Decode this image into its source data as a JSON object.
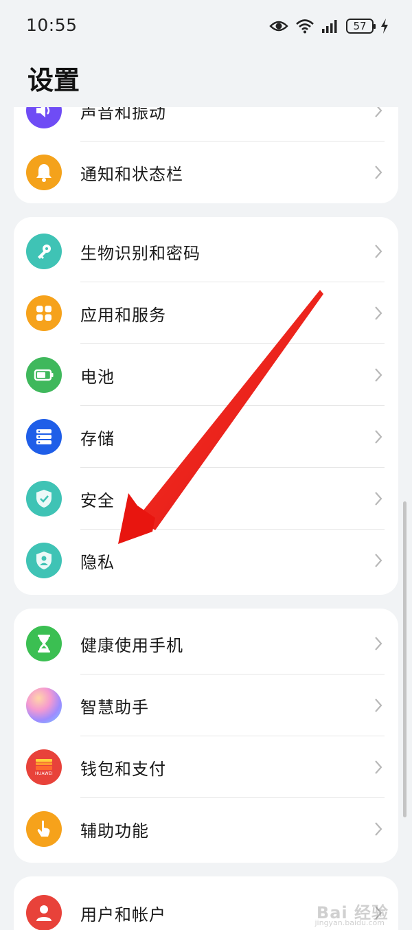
{
  "status_bar": {
    "time": "10:55",
    "battery": "57",
    "icons": [
      "eye-icon",
      "wifi-icon",
      "signal-icon",
      "battery-icon",
      "charging-icon"
    ]
  },
  "page": {
    "title": "设置"
  },
  "groups": [
    {
      "items": [
        {
          "label": "声音和振动",
          "icon": "speaker-icon",
          "color": "#6f4cf5"
        },
        {
          "label": "通知和状态栏",
          "icon": "bell-icon",
          "color": "#f4a21b"
        }
      ]
    },
    {
      "items": [
        {
          "label": "生物识别和密码",
          "icon": "key-icon",
          "color": "#3fc3b5"
        },
        {
          "label": "应用和服务",
          "icon": "apps-grid-icon",
          "color": "#f6a21b"
        },
        {
          "label": "电池",
          "icon": "battery-icon",
          "color": "#3fb85c"
        },
        {
          "label": "存储",
          "icon": "storage-icon",
          "color": "#1f5ee8"
        },
        {
          "label": "安全",
          "icon": "shield-check-icon",
          "color": "#3fc3b5"
        },
        {
          "label": "隐私",
          "icon": "privacy-shield-icon",
          "color": "#3fc3b5"
        }
      ]
    },
    {
      "items": [
        {
          "label": "健康使用手机",
          "icon": "hourglass-icon",
          "color": "#3bbf52"
        },
        {
          "label": "智慧助手",
          "icon": "assistant-orb-icon",
          "color": "#b58cff"
        },
        {
          "label": "钱包和支付",
          "icon": "wallet-icon",
          "color": "#e8423a"
        },
        {
          "label": "辅助功能",
          "icon": "hand-pointer-icon",
          "color": "#f6a21b"
        }
      ]
    },
    {
      "items": [
        {
          "label": "用户和帐户",
          "icon": "user-icon",
          "color": "#e8423a"
        }
      ]
    }
  ],
  "wallet_icon_text": "HUAWEI",
  "watermark": {
    "text": "Bai 经验",
    "sub": "jingyan.baidu.com"
  }
}
